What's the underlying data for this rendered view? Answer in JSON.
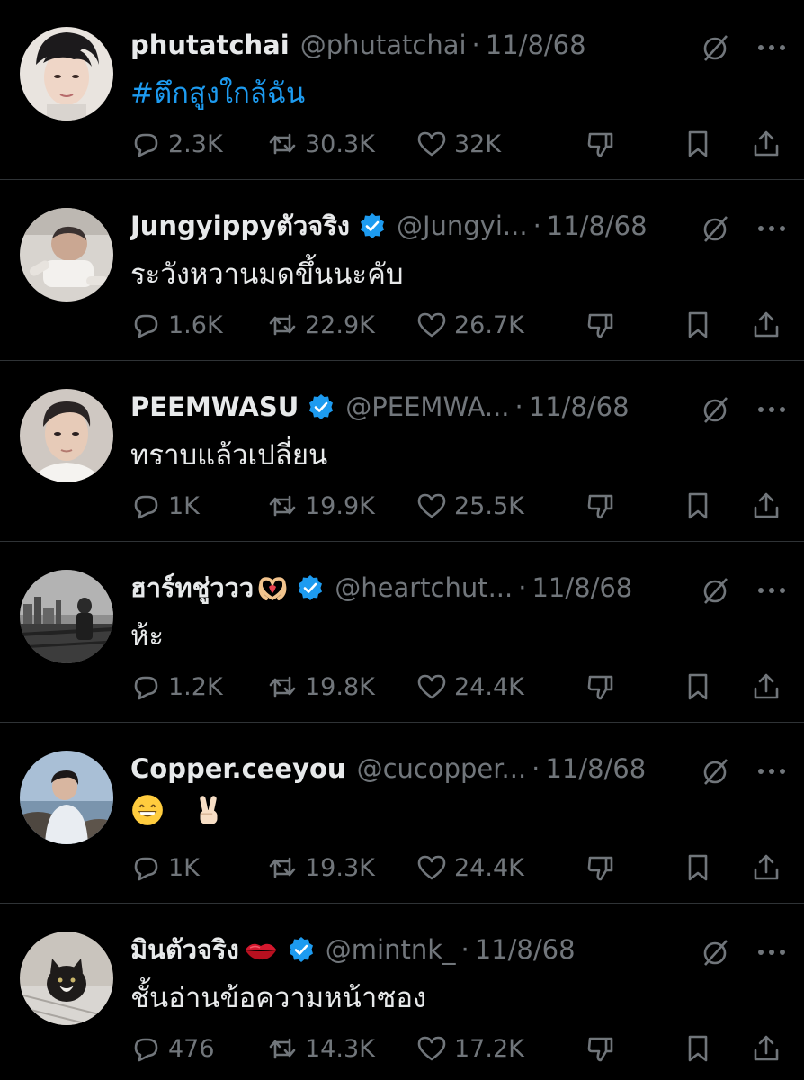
{
  "tweets": [
    {
      "name": "phutatchai",
      "verified": false,
      "name_emoji": "",
      "handle": "@phutatchai",
      "separator": "·",
      "time": "11/8/68",
      "text": "#ตึกสูงใกล้ฉัน",
      "text_is_link": true,
      "text_emoji": [],
      "replies": "2.3K",
      "reposts": "30.3K",
      "likes": "32K",
      "avatar_icon": "avatar-portrait-phutatchai"
    },
    {
      "name": "Jungyippyตัวจริง",
      "verified": true,
      "name_emoji": "",
      "handle": "@Jungyi...",
      "separator": "·",
      "time": "11/8/68",
      "text": "ระวังหวานมดขึ้นนะคับ",
      "text_is_link": false,
      "text_emoji": [],
      "replies": "1.6K",
      "reposts": "22.9K",
      "likes": "26.7K",
      "avatar_icon": "avatar-baby-photo"
    },
    {
      "name": "PEEMWASU",
      "verified": true,
      "name_emoji": "",
      "handle": "@PEEMWA...",
      "separator": "·",
      "time": "11/8/68",
      "text": "ทราบแล้วเปลี่ยน",
      "text_is_link": false,
      "text_emoji": [],
      "replies": "1K",
      "reposts": "19.9K",
      "likes": "25.5K",
      "avatar_icon": "avatar-portrait-peemwasu"
    },
    {
      "name": "ฮาร์ทชู่ววว",
      "verified": true,
      "name_emoji": "heart-hands",
      "handle": "@heartchut...",
      "separator": "·",
      "time": "11/8/68",
      "text": "ห้ะ",
      "text_is_link": false,
      "text_emoji": [],
      "replies": "1.2K",
      "reposts": "19.8K",
      "likes": "24.4K",
      "avatar_icon": "avatar-city-bw-photo"
    },
    {
      "name": "Copper.ceeyou",
      "verified": false,
      "name_emoji": "",
      "handle": "@cucopper...",
      "separator": "·",
      "time": "11/8/68",
      "text": "",
      "text_is_link": false,
      "text_emoji": [
        "grinning-face",
        "victory-hand"
      ],
      "replies": "1K",
      "reposts": "19.3K",
      "likes": "24.4K",
      "avatar_icon": "avatar-beach-photo"
    },
    {
      "name": "มินตัวจริง",
      "verified": true,
      "name_emoji": "kiss-mark",
      "handle": "@mintnk_",
      "separator": "·",
      "time": "11/8/68",
      "text": "ชั้นอ่านข้อความหน้าซอง",
      "text_is_link": false,
      "text_emoji": [],
      "replies": "476",
      "reposts": "14.3K",
      "likes": "17.2K",
      "avatar_icon": "avatar-cat-photo"
    }
  ],
  "colors": {
    "background": "#000000",
    "text": "#e7e9ea",
    "muted": "#71767b",
    "link": "#1d9bf0",
    "verified": "#1d9bf0",
    "divider": "#2f3336"
  }
}
